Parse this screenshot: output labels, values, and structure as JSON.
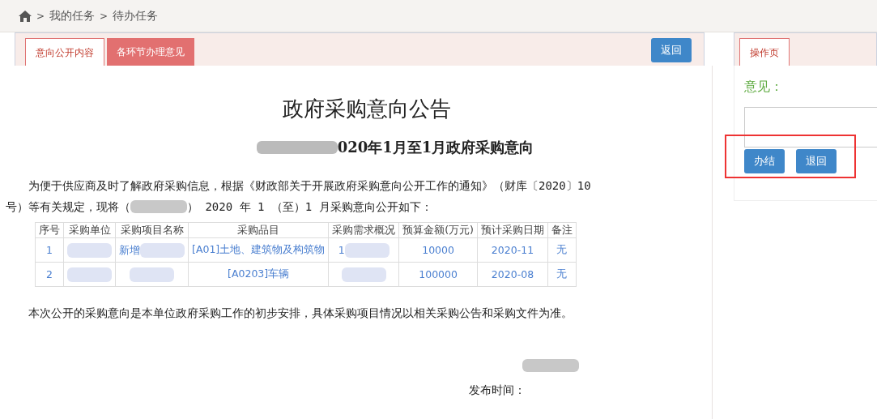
{
  "breadcrumb": {
    "items": [
      {
        "label": "我的任务"
      },
      {
        "label": "待办任务"
      }
    ],
    "separator": ">"
  },
  "main_panel": {
    "tabs": [
      {
        "label": "意向公开内容",
        "selected": true
      },
      {
        "label": "各环节办理意见",
        "selected": false
      }
    ],
    "back_button": "返回"
  },
  "document": {
    "title": "政府采购意向公告",
    "subtitle": "020年1月至1月政府采购意向",
    "intro_line1": "为便于供应商及时了解政府采购信息，根据《财政部关于开展政府采购意向公开工作的通知》（财库〔2020〕10",
    "intro_before": "号）等有关规定，现将（",
    "intro_after": "） 2020 年 1 （至）1 月采购意向公开如下：",
    "table": {
      "columns": [
        "序号",
        "采购单位",
        "采购项目名称",
        "采购品目",
        "采购需求概况",
        "预算金额(万元)",
        "预计采购日期",
        "备注"
      ],
      "rows": [
        [
          "1",
          "",
          "新增",
          "[A01]土地、建筑物及构筑物",
          "1",
          "10000",
          "2020-11",
          "无"
        ],
        [
          "2",
          "",
          "",
          "[A0203]车辆",
          "",
          "100000",
          "2020-08",
          "无"
        ]
      ]
    },
    "closing": "本次公开的采购意向是本单位政府采购工作的初步安排，具体采购项目情况以相关采购公告和采购文件为准。",
    "publish_label": "发布时间："
  },
  "side_panel": {
    "tabs": [
      {
        "label": "操作页",
        "selected": true
      }
    ],
    "opinion_label": "意见：",
    "buttons": [
      "办结",
      "退回"
    ]
  }
}
